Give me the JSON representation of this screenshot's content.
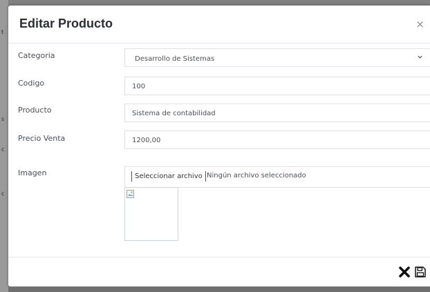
{
  "modal": {
    "title": "Editar Producto",
    "close_label": "×"
  },
  "form": {
    "category": {
      "label": "Categoria",
      "selected_value": "Desarrollo de Sistemas",
      "chevron_icon": "chevron-down-icon"
    },
    "code": {
      "label": "Codigo",
      "value": "100"
    },
    "product": {
      "label": "Producto",
      "value": "Sistema de contabilidad"
    },
    "price": {
      "label": "Precio Venta",
      "value": "1200,00"
    },
    "image": {
      "label": "Imagen",
      "file_button_label": "Seleccionar archivo",
      "file_status": "Ningún archivo seleccionado",
      "preview_icon": "broken-image-icon"
    }
  },
  "footer": {
    "cancel_icon": "x-mark-icon",
    "save_icon": "floppy-disk-icon"
  }
}
